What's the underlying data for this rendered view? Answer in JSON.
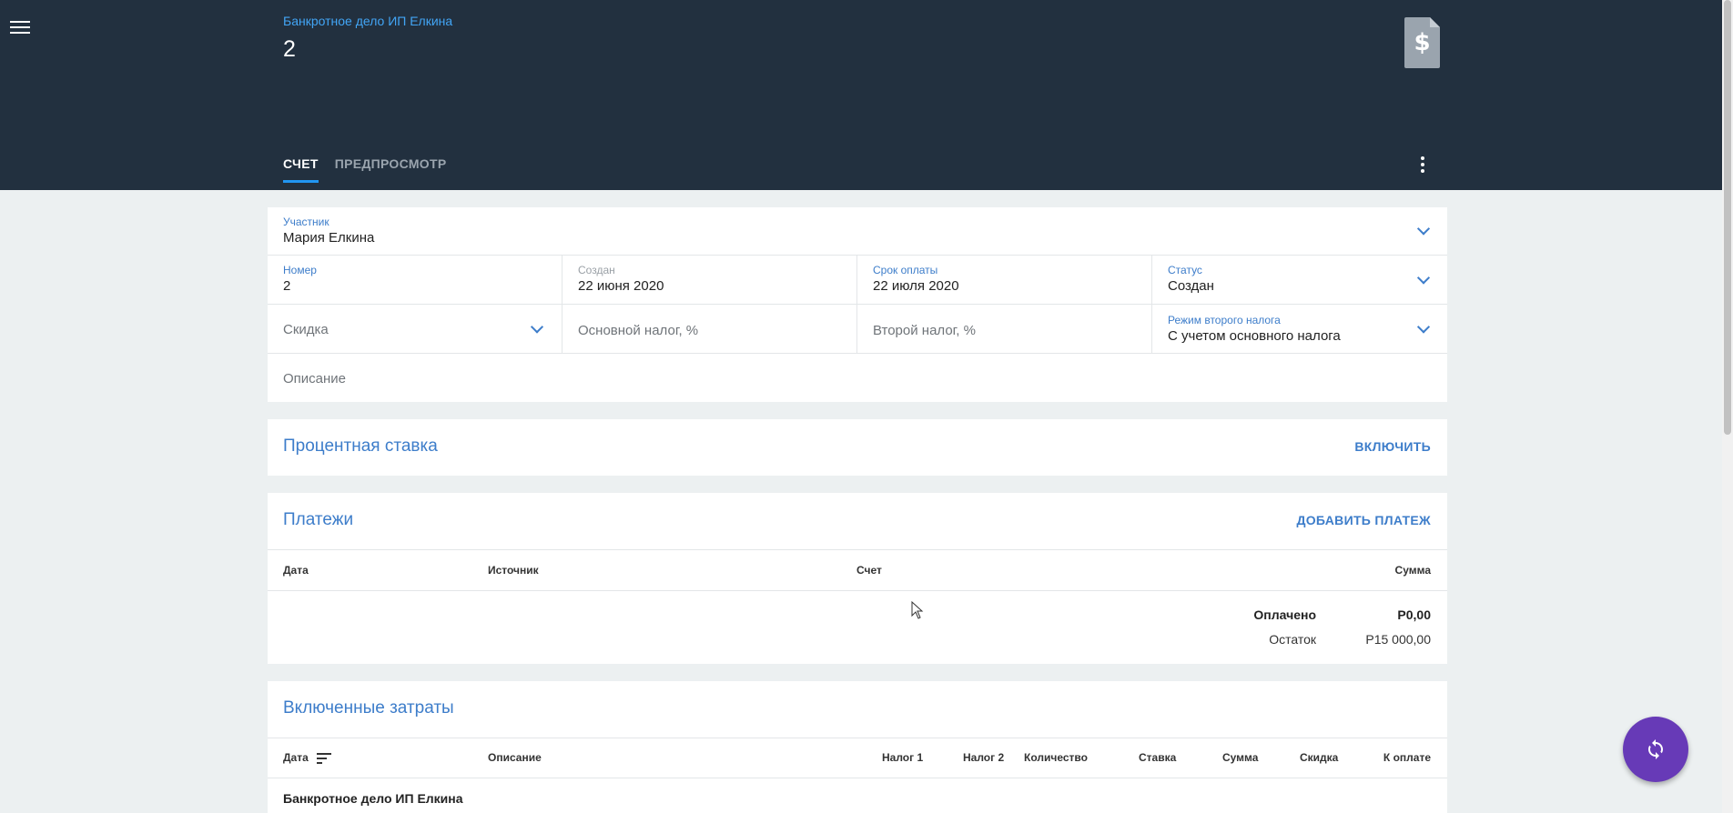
{
  "header": {
    "breadcrumb": "Банкротное дело ИП Елкина",
    "title": "2",
    "tabs": [
      {
        "label": "СЧЕТ",
        "active": true
      },
      {
        "label": "ПРЕДПРОСМОТР",
        "active": false
      }
    ],
    "icons": {
      "menu": "menu-icon",
      "document": "invoice-dollar-icon",
      "more": "more-vert-icon"
    }
  },
  "form": {
    "participant": {
      "label": "Участник",
      "value": "Мария Елкина"
    },
    "number": {
      "label": "Номер",
      "value": "2"
    },
    "created": {
      "label": "Создан",
      "value": "22 июня 2020"
    },
    "due": {
      "label": "Срок оплаты",
      "value": "22 июля 2020"
    },
    "status": {
      "label": "Статус",
      "value": "Создан"
    },
    "discount": {
      "placeholder": "Скидка"
    },
    "main_tax": {
      "placeholder": "Основной налог, %"
    },
    "second_tax": {
      "placeholder": "Второй налог, %"
    },
    "second_tax_mode": {
      "label": "Режим второго налога",
      "value": "С учетом основного налога"
    },
    "description": {
      "placeholder": "Описание"
    }
  },
  "interest": {
    "title": "Процентная ставка",
    "action": "ВКЛЮЧИТЬ"
  },
  "payments": {
    "title": "Платежи",
    "action": "ДОБАВИТЬ ПЛАТЕЖ",
    "columns": [
      "Дата",
      "Источник",
      "Счет",
      "Сумма"
    ],
    "paid_label": "Оплачено",
    "paid_value": "Р0,00",
    "balance_label": "Остаток",
    "balance_value": "Р15 000,00"
  },
  "expenses": {
    "title": "Включенные затраты",
    "columns": [
      "Дата",
      "Описание",
      "Налог 1",
      "Налог 2",
      "Количество",
      "Ставка",
      "Сумма",
      "Скидка",
      "К оплате"
    ],
    "group": "Банкротное дело ИП Елкина"
  },
  "colors": {
    "header_bg": "#22303f",
    "accent": "#3d7dca",
    "fab": "#673ab7",
    "tab_underline": "#2196f3"
  }
}
